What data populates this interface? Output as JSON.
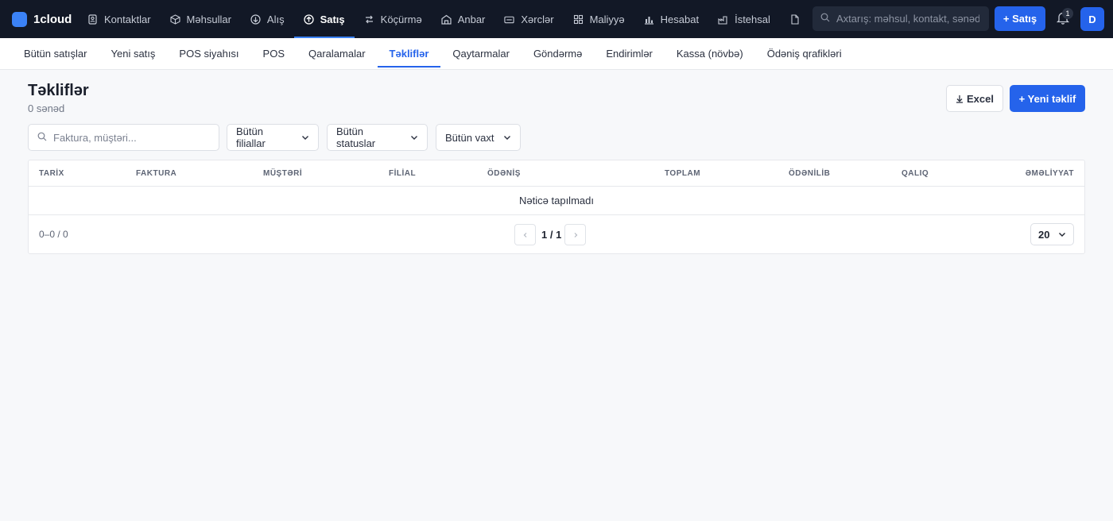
{
  "brand": {
    "name": "1cloud",
    "logo_color": "#3b82f6"
  },
  "nav": [
    {
      "label": "Kontaktlar",
      "icon": "contacts-icon"
    },
    {
      "label": "Məhsullar",
      "icon": "box-icon"
    },
    {
      "label": "Alış",
      "icon": "download-circle-icon"
    },
    {
      "label": "Satış",
      "icon": "upload-circle-icon",
      "active": true
    },
    {
      "label": "Köçürmə",
      "icon": "transfer-icon"
    },
    {
      "label": "Anbar",
      "icon": "warehouse-icon"
    },
    {
      "label": "Xərclər",
      "icon": "wallet-icon"
    },
    {
      "label": "Maliyyə",
      "icon": "grid-icon"
    },
    {
      "label": "Hesabat",
      "icon": "bar-chart-icon"
    },
    {
      "label": "İstehsal",
      "icon": "factory-icon"
    },
    {
      "label": "",
      "icon": "document-icon"
    }
  ],
  "search": {
    "placeholder": "Axtarış: məhsul, kontakt, sənəd..."
  },
  "sale_button": "+ Satış",
  "notifications": {
    "count": "1"
  },
  "avatar": "D",
  "subnav": [
    {
      "label": "Bütün satışlar"
    },
    {
      "label": "Yeni satış"
    },
    {
      "label": "POS siyahısı"
    },
    {
      "label": "POS"
    },
    {
      "label": "Qaralamalar"
    },
    {
      "label": "Təkliflər",
      "active": true
    },
    {
      "label": "Qaytarmalar"
    },
    {
      "label": "Göndərmə"
    },
    {
      "label": "Endirimlər"
    },
    {
      "label": "Kassa (növbə)"
    },
    {
      "label": "Ödəniş qrafikləri"
    }
  ],
  "page": {
    "title": "Təkliflər",
    "subtitle": "0 sənəd"
  },
  "actions": {
    "excel": "Excel",
    "new_offer": "+ Yeni təklif"
  },
  "filters": {
    "search_placeholder": "Faktura, müştəri...",
    "branch": "Bütün filiallar",
    "status": "Bütün statuslar",
    "time": "Bütün vaxt"
  },
  "table": {
    "columns": [
      "TARİX",
      "FAKTURA",
      "MÜŞTƏRİ",
      "FİLİAL",
      "ÖDƏNİŞ",
      "TOPLAM",
      "ÖDƏNİLİB",
      "QALIQ",
      "ƏMƏLİYYAT"
    ],
    "empty_message": "Nəticə tapılmadı",
    "range": "0–0 / 0",
    "page_label": "1 / 1",
    "per_page": "20"
  },
  "colors": {
    "accent": "#2563eb",
    "topbar": "#121826"
  }
}
